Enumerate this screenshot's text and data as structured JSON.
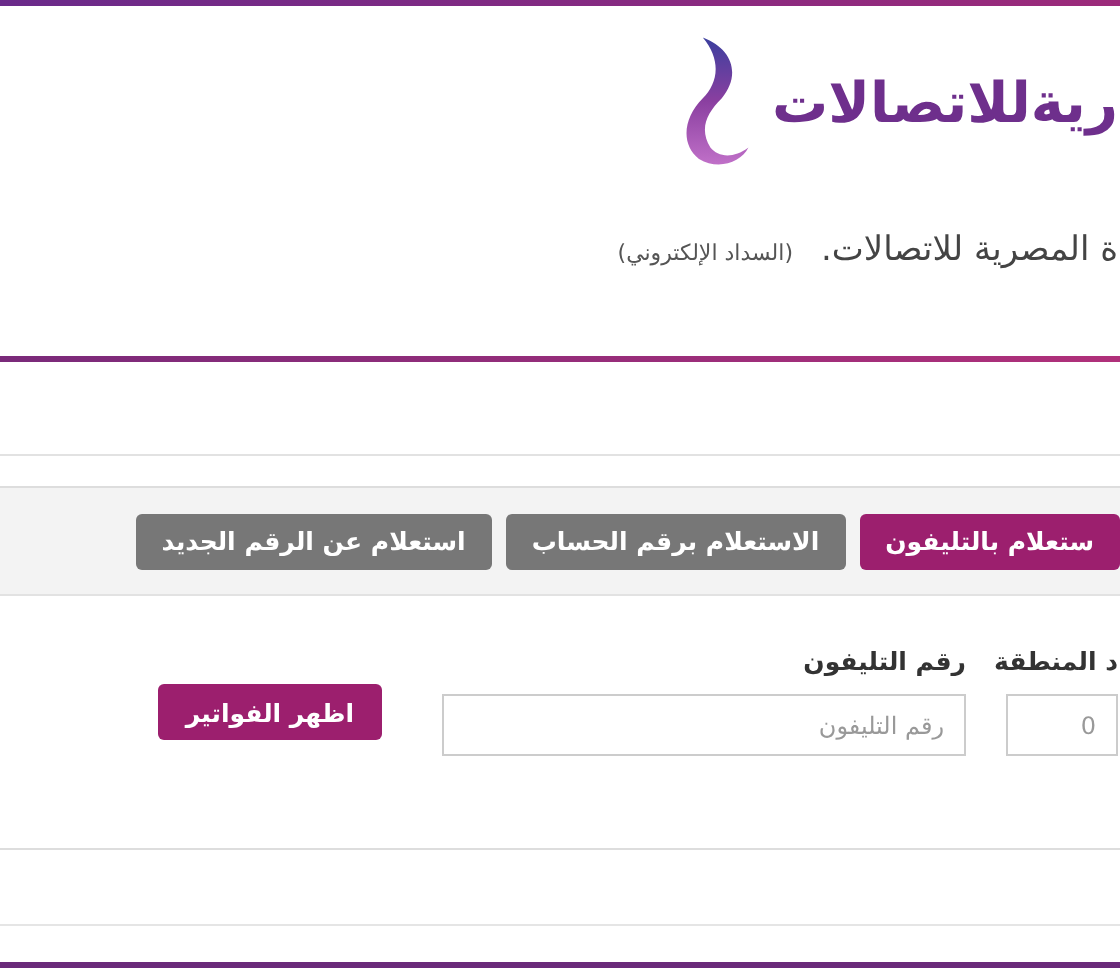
{
  "logo": {
    "text": "ريةللاتصالات"
  },
  "heading": {
    "title": "ة المصرية للاتصالات.",
    "note": "(السداد الإلكتروني)"
  },
  "tabs": [
    {
      "label": "ستعلام بالتليفون",
      "selected": true
    },
    {
      "label": "الاستعلام برقم الحساب",
      "selected": false
    },
    {
      "label": "استعلام عن الرقم الجديد",
      "selected": false
    }
  ],
  "form": {
    "fields": [
      {
        "label": "د المنطقة",
        "placeholder": "0",
        "kind": "area"
      },
      {
        "label": "رقم التليفون",
        "placeholder": "رقم التليفون",
        "kind": "phone"
      }
    ],
    "submit": "اظهر الفواتير"
  }
}
